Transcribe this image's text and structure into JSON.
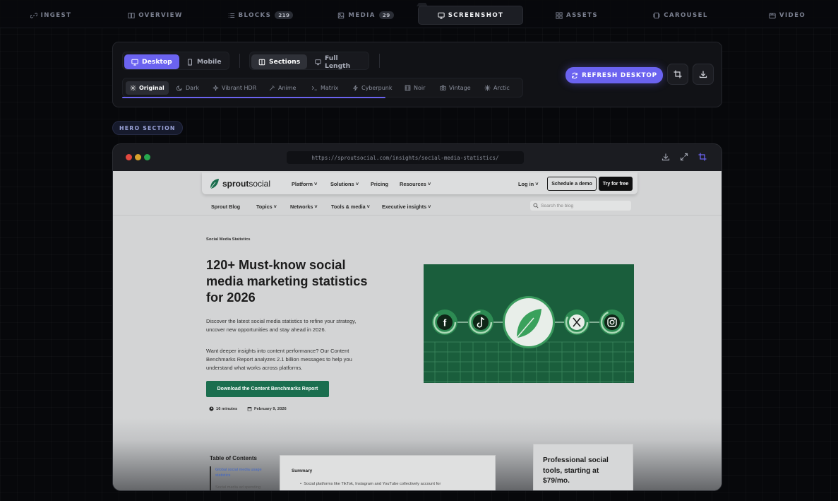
{
  "topnav": {
    "tabs": [
      {
        "label": "INGEST",
        "icon": "link-icon"
      },
      {
        "label": "OVERVIEW",
        "icon": "book-icon"
      },
      {
        "label": "BLOCKS",
        "icon": "list-icon",
        "count": "219"
      },
      {
        "label": "MEDIA",
        "icon": "image-icon",
        "count": "29"
      },
      {
        "label": "SCREENSHOT",
        "icon": "monitor-icon",
        "active": true
      },
      {
        "label": "ASSETS",
        "icon": "grid-icon"
      },
      {
        "label": "CAROUSEL",
        "icon": "carousel-icon"
      },
      {
        "label": "VIDEO",
        "icon": "video-icon"
      }
    ]
  },
  "controls": {
    "device": {
      "desktop": "Desktop",
      "mobile": "Mobile"
    },
    "mode": {
      "sections": "Sections",
      "full_length": "Full Length"
    },
    "filters": [
      "Original",
      "Dark",
      "Vibrant HDR",
      "Anime",
      "Matrix",
      "Cyberpunk",
      "Noir",
      "Vintage",
      "Arctic"
    ],
    "refresh_label": "REFRESH DESKTOP"
  },
  "section_badge": "HERO SECTION",
  "browser": {
    "url": "https://sproutsocial.com/insights/social-media-statistics/"
  },
  "site": {
    "logo": {
      "bold": "sprout",
      "rest": "social"
    },
    "nav": {
      "platform": "Platform",
      "solutions": "Solutions",
      "pricing": "Pricing",
      "resources": "Resources",
      "login": "Log in",
      "demo": "Schedule a demo",
      "try": "Try for free"
    },
    "subnav": {
      "blog": "Sprout Blog",
      "topics": "Topics",
      "networks": "Networks",
      "tools": "Tools & media",
      "exec": "Executive insights",
      "search_placeholder": "Search the blog"
    },
    "eyebrow": "Social Media Statistics",
    "title": "120+ Must-know social media marketing statistics for 2026",
    "para1": "Discover the latest social media statistics to refine your strategy, uncover new opportunities and stay ahead in 2026.",
    "para2": "Want deeper insights into content performance? Our Content Benchmarks Report analyzes 2.1 billion messages to help you understand what works across platforms.",
    "cta": "Download the Content Benchmarks Report",
    "read_time": "16 minutes",
    "date": "February 9, 2026",
    "toc_title": "Table of Contents",
    "toc_item1": "Global social media usage statistics",
    "toc_item2": "Social media ad spending",
    "summary_title": "Summary",
    "summary_bullet": "Social platforms like TikTok, Instagram and YouTube collectively account for",
    "promo_title": "Professional social tools, starting at $79/mo."
  },
  "colors": {
    "accent": "#6b63f0",
    "sprout_green": "#1b6e4f"
  }
}
